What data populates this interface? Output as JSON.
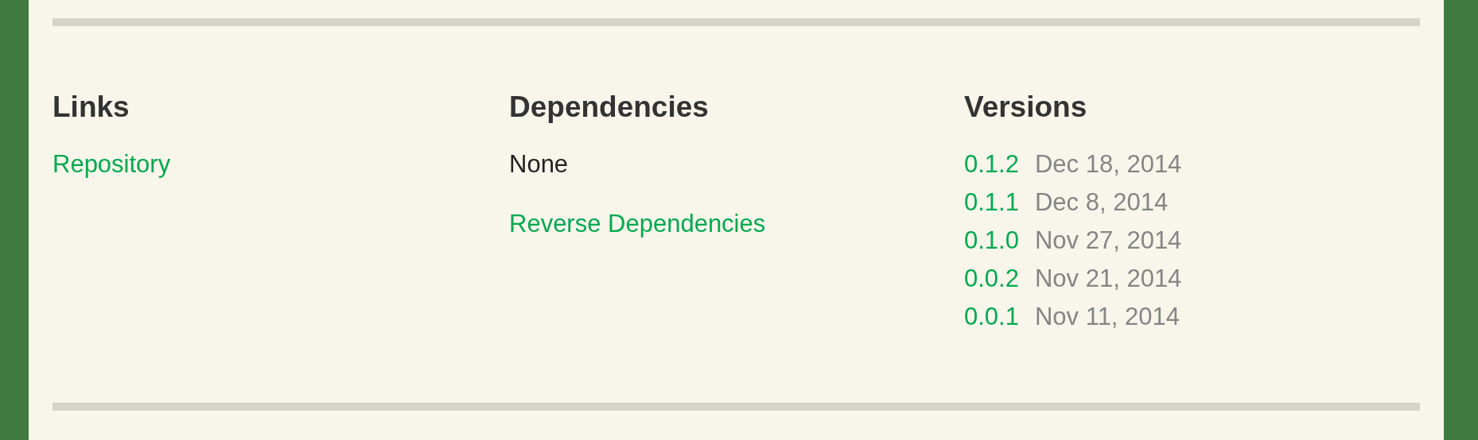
{
  "links": {
    "heading": "Links",
    "items": [
      "Repository"
    ]
  },
  "dependencies": {
    "heading": "Dependencies",
    "none_text": "None",
    "reverse_link": "Reverse Dependencies"
  },
  "versions": {
    "heading": "Versions",
    "items": [
      {
        "version": "0.1.2",
        "date": "Dec 18, 2014"
      },
      {
        "version": "0.1.1",
        "date": "Dec 8, 2014"
      },
      {
        "version": "0.1.0",
        "date": "Nov 27, 2014"
      },
      {
        "version": "0.0.2",
        "date": "Nov 21, 2014"
      },
      {
        "version": "0.0.1",
        "date": "Nov 11, 2014"
      }
    ]
  }
}
